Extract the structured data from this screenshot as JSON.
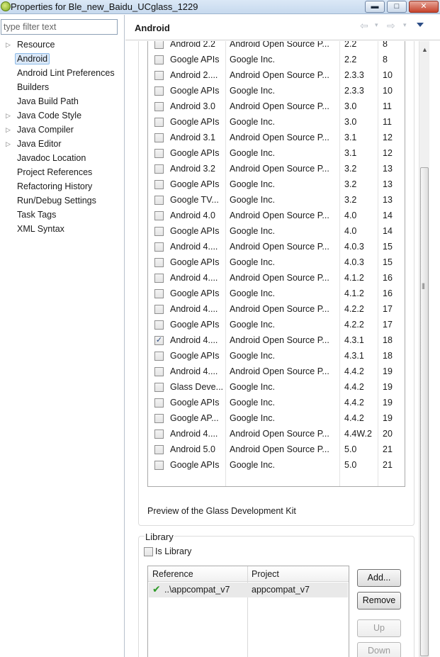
{
  "window": {
    "title": "Properties for Ble_new_Baidu_UCglass_1229",
    "minimize": "▬",
    "maximize": "□",
    "close": "✕"
  },
  "filter": {
    "placeholder": "type filter text"
  },
  "nav": {
    "items": [
      {
        "label": "Resource",
        "expandable": true
      },
      {
        "label": "Android",
        "selected": true
      },
      {
        "label": "Android Lint Preferences"
      },
      {
        "label": "Builders"
      },
      {
        "label": "Java Build Path"
      },
      {
        "label": "Java Code Style",
        "expandable": true
      },
      {
        "label": "Java Compiler",
        "expandable": true
      },
      {
        "label": "Java Editor",
        "expandable": true
      },
      {
        "label": "Javadoc Location"
      },
      {
        "label": "Project References"
      },
      {
        "label": "Refactoring History"
      },
      {
        "label": "Run/Debug Settings"
      },
      {
        "label": "Task Tags"
      },
      {
        "label": "XML Syntax"
      }
    ]
  },
  "page": {
    "title": "Android",
    "back": "⇦",
    "forward": "⇨",
    "dropdown": "▾"
  },
  "targets": {
    "rows": [
      {
        "name": "Android 2.2",
        "vendor": "Android Open Source P...",
        "platform": "2.2",
        "api": "8",
        "checked": false
      },
      {
        "name": "Google APIs",
        "vendor": "Google Inc.",
        "platform": "2.2",
        "api": "8",
        "checked": false
      },
      {
        "name": "Android 2....",
        "vendor": "Android Open Source P...",
        "platform": "2.3.3",
        "api": "10",
        "checked": false
      },
      {
        "name": "Google APIs",
        "vendor": "Google Inc.",
        "platform": "2.3.3",
        "api": "10",
        "checked": false
      },
      {
        "name": "Android 3.0",
        "vendor": "Android Open Source P...",
        "platform": "3.0",
        "api": "11",
        "checked": false
      },
      {
        "name": "Google APIs",
        "vendor": "Google Inc.",
        "platform": "3.0",
        "api": "11",
        "checked": false
      },
      {
        "name": "Android 3.1",
        "vendor": "Android Open Source P...",
        "platform": "3.1",
        "api": "12",
        "checked": false
      },
      {
        "name": "Google APIs",
        "vendor": "Google Inc.",
        "platform": "3.1",
        "api": "12",
        "checked": false
      },
      {
        "name": "Android 3.2",
        "vendor": "Android Open Source P...",
        "platform": "3.2",
        "api": "13",
        "checked": false
      },
      {
        "name": "Google APIs",
        "vendor": "Google Inc.",
        "platform": "3.2",
        "api": "13",
        "checked": false
      },
      {
        "name": "Google TV...",
        "vendor": "Google Inc.",
        "platform": "3.2",
        "api": "13",
        "checked": false
      },
      {
        "name": "Android 4.0",
        "vendor": "Android Open Source P...",
        "platform": "4.0",
        "api": "14",
        "checked": false
      },
      {
        "name": "Google APIs",
        "vendor": "Google Inc.",
        "platform": "4.0",
        "api": "14",
        "checked": false
      },
      {
        "name": "Android 4....",
        "vendor": "Android Open Source P...",
        "platform": "4.0.3",
        "api": "15",
        "checked": false
      },
      {
        "name": "Google APIs",
        "vendor": "Google Inc.",
        "platform": "4.0.3",
        "api": "15",
        "checked": false
      },
      {
        "name": "Android 4....",
        "vendor": "Android Open Source P...",
        "platform": "4.1.2",
        "api": "16",
        "checked": false
      },
      {
        "name": "Google APIs",
        "vendor": "Google Inc.",
        "platform": "4.1.2",
        "api": "16",
        "checked": false
      },
      {
        "name": "Android 4....",
        "vendor": "Android Open Source P...",
        "platform": "4.2.2",
        "api": "17",
        "checked": false
      },
      {
        "name": "Google APIs",
        "vendor": "Google Inc.",
        "platform": "4.2.2",
        "api": "17",
        "checked": false
      },
      {
        "name": "Android 4....",
        "vendor": "Android Open Source P...",
        "platform": "4.3.1",
        "api": "18",
        "checked": true
      },
      {
        "name": "Google APIs",
        "vendor": "Google Inc.",
        "platform": "4.3.1",
        "api": "18",
        "checked": false
      },
      {
        "name": "Android 4....",
        "vendor": "Android Open Source P...",
        "platform": "4.4.2",
        "api": "19",
        "checked": false
      },
      {
        "name": "Glass Deve...",
        "vendor": "Google Inc.",
        "platform": "4.4.2",
        "api": "19",
        "checked": false
      },
      {
        "name": "Google APIs",
        "vendor": "Google Inc.",
        "platform": "4.4.2",
        "api": "19",
        "checked": false
      },
      {
        "name": "Google AP...",
        "vendor": "Google Inc.",
        "platform": "4.4.2",
        "api": "19",
        "checked": false
      },
      {
        "name": "Android 4....",
        "vendor": "Android Open Source P...",
        "platform": "4.4W.2",
        "api": "20",
        "checked": false
      },
      {
        "name": "Android 5.0",
        "vendor": "Android Open Source P...",
        "platform": "5.0",
        "api": "21",
        "checked": false
      },
      {
        "name": "Google APIs",
        "vendor": "Google Inc.",
        "platform": "5.0",
        "api": "21",
        "checked": false
      }
    ],
    "description": "Preview of the Glass Development Kit"
  },
  "library": {
    "title": "Library",
    "is_library_label": "Is Library",
    "is_library_checked": false,
    "headers": [
      "Reference",
      "Project"
    ],
    "rows": [
      {
        "reference": "..\\appcompat_v7",
        "project": "appcompat_v7"
      }
    ],
    "buttons": {
      "add": "Add...",
      "remove": "Remove",
      "up": "Up",
      "down": "Down"
    }
  },
  "icons": {
    "checkmark": "✔",
    "tree_arrow": "▷",
    "check": "✓"
  }
}
